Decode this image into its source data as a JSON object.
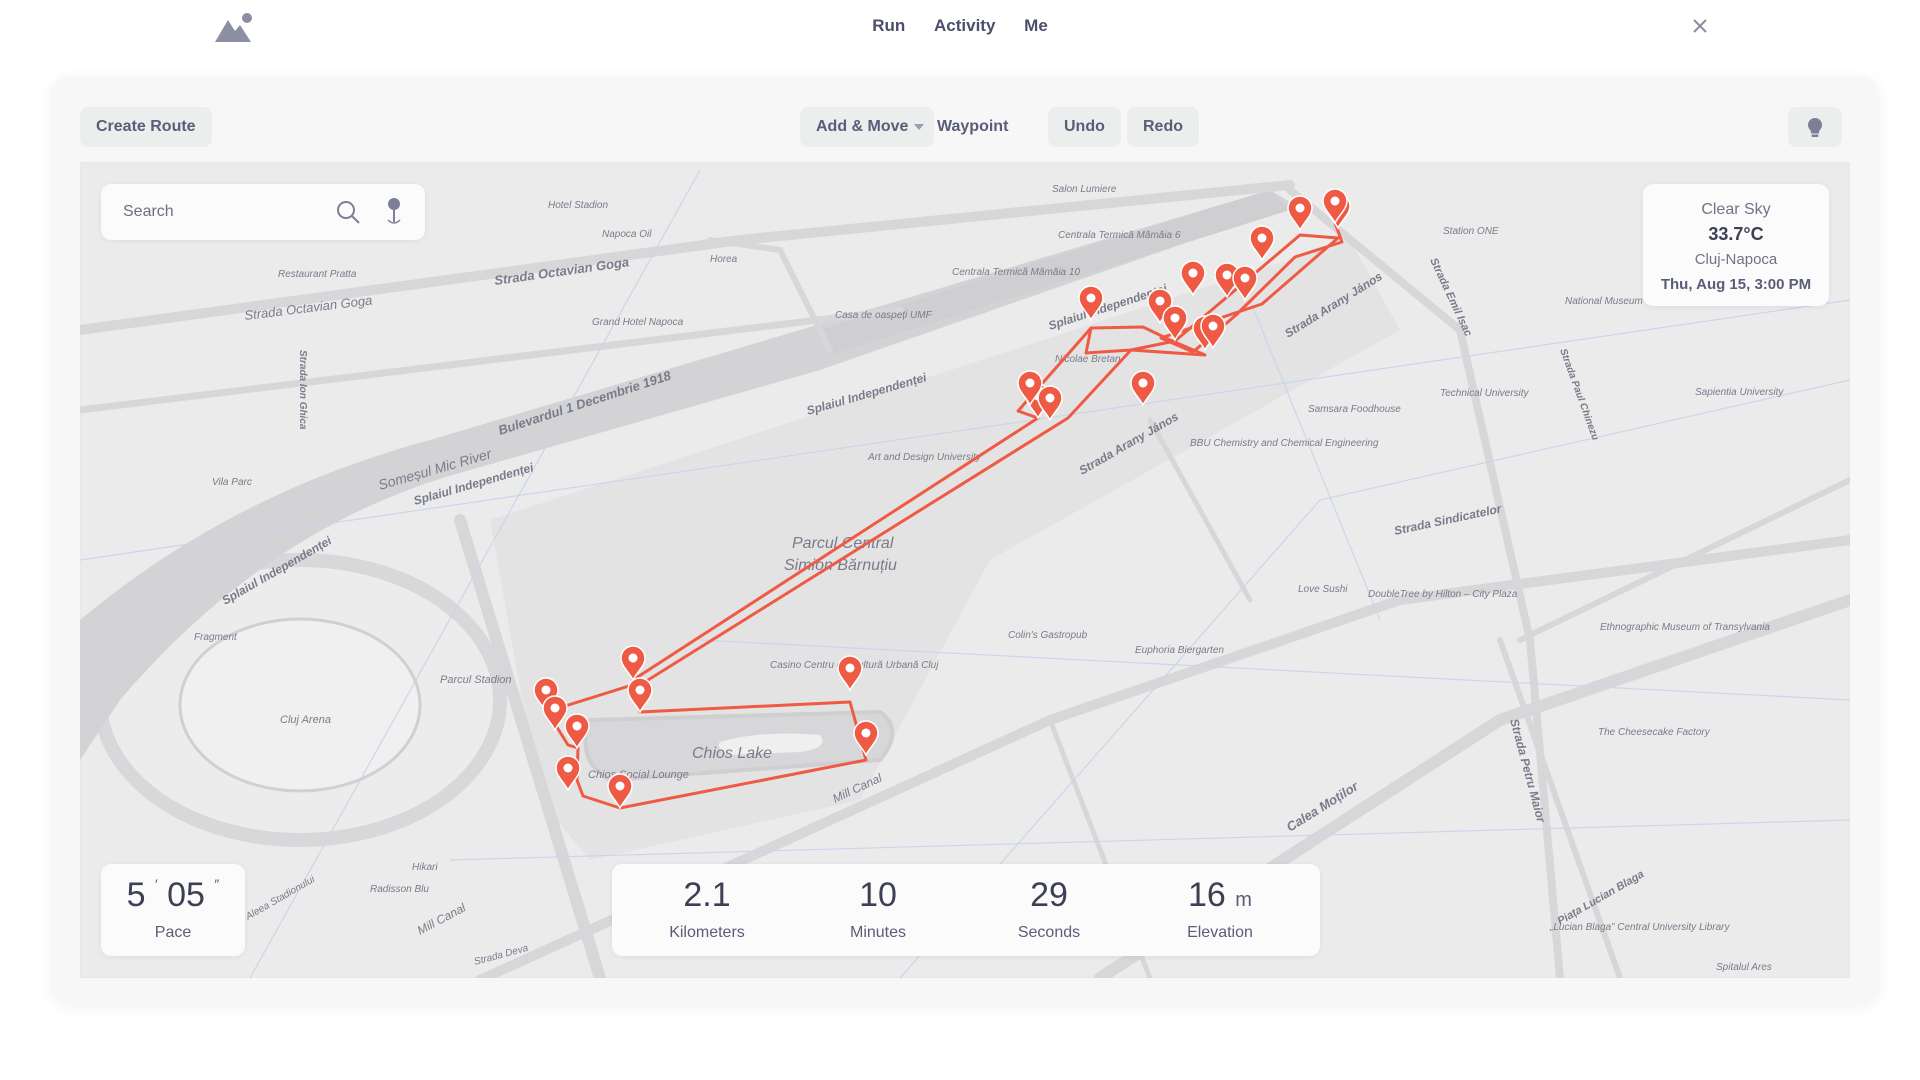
{
  "nav": {
    "items": [
      "Run",
      "Activity",
      "Me"
    ]
  },
  "toolbar": {
    "create_route": "Create Route",
    "mode": "Add & Move",
    "waypoint": "Waypoint",
    "undo": "Undo",
    "redo": "Redo"
  },
  "search": {
    "placeholder": "Search"
  },
  "weather": {
    "condition": "Clear Sky",
    "temperature": "33.7°C",
    "city": "Cluj-Napoca",
    "datetime": "Thu, Aug 15, 3:00 PM"
  },
  "pace": {
    "minutes": "5",
    "seconds": "05",
    "label": "Pace"
  },
  "stats": {
    "distance": {
      "value": "2.1",
      "label": "Kilometers"
    },
    "minutes": {
      "value": "10",
      "label": "Minutes"
    },
    "seconds": {
      "value": "29",
      "label": "Seconds"
    },
    "elevation": {
      "value": "16",
      "unit": "m",
      "label": "Elevation"
    }
  },
  "map": {
    "route_color": "#ef5a45",
    "labels": {
      "somesul": "Someșul Mic River",
      "splaiul_1": "Splaiul Independenței",
      "splaiul_2": "Splaiul Independenței",
      "splaiul_3": "Splaiul Independenței",
      "splaiul_4": "Splaiul Independenței",
      "bulevardul": "Bulevardul 1 Decembrie 1918",
      "octavian_1": "Strada Octavian Goga",
      "octavian_2": "Strada Octavian Goga",
      "parcul": "Parcul Central",
      "simion": "Simion Bărnuțiu",
      "chios_lake": "Chios Lake",
      "chios_lounge": "Chios Social Lounge",
      "cluj_arena": "Cluj Arena",
      "parcul_stadion": "Parcul Stadion",
      "arany_1": "Strada Arany János",
      "arany_2": "Strada Arany János",
      "emil_isac": "Strada Emil Isac",
      "sindicatelor": "Strada Sindicatelor",
      "calea_motilor": "Calea Moților",
      "petru_maior": "Strada Petru Maior",
      "mill_canal_1": "Mill Canal",
      "mill_canal_2": "Mill Canal",
      "hotel_stadion": "Hotel Stadion",
      "napoca_oil": "Napoca Oil",
      "horea": "Horea",
      "salon_lumiere": "Salon Lumiere",
      "centrala_6": "Centrala Termică Mămăia 6",
      "centrala_10": "Centrala Termică Mămăia 10",
      "casa_oaspeti": "Casa de oaspeți UMF",
      "grand_hotel": "Grand Hotel Napoca",
      "restaurant_pratta": "Restaurant Pratta",
      "nicolae": "Nicolae Bretan",
      "art_design": "Art and Design University",
      "bbu": "BBU Chemistry and Chemical Engineering",
      "samsara": "Samsara Foodhouse",
      "technical": "Technical University",
      "national_museum": "National Museum of Transylvanian History",
      "station_one": "Station ONE",
      "love_sushi": "Love Sushi",
      "doubletree": "DoubleTree by Hilton – City Plaza",
      "colins": "Colin's Gastropub",
      "euphoria": "Euphoria Biergarten",
      "casino": "Casino Centru de Cultură Urbană Cluj",
      "ethnographic": "Ethnographic Museum of Transylvania",
      "cheesecake": "The Cheesecake Factory",
      "lucian_blaga": "„Lucian Blaga” Central University Library",
      "fragment": "Fragment",
      "vila_parc": "Vila Parc",
      "hikari": "Hikari",
      "radisson": "Radisson Blu",
      "aleea": "Aleea Stadionului",
      "strada_deva": "Strada Deva",
      "sapientia": "Sapientia University",
      "strada_paul": "Strada Paul Chinezu",
      "piata_lucian": "Piața Lucian Blaga",
      "spitalul": "Spitalul Ares",
      "ion_ghica": "Strada Ion Ghica"
    }
  }
}
